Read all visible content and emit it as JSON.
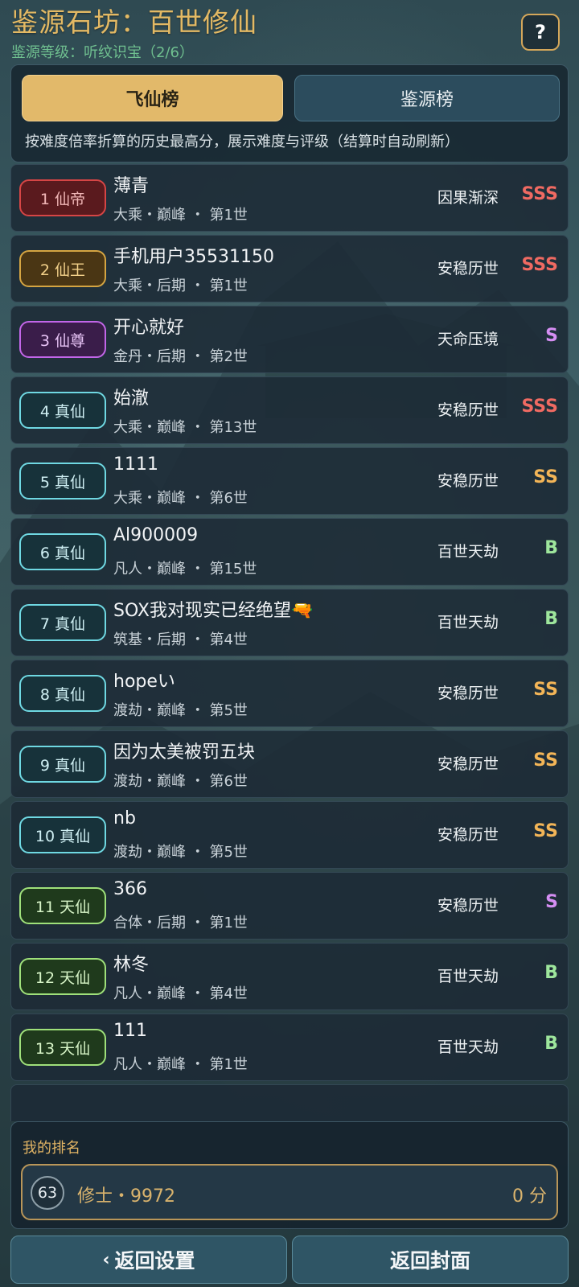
{
  "header": {
    "title": "鉴源石坊：百世修仙",
    "subtitle": "鉴源等级：听纹识宝（2/6）",
    "help_label": "?"
  },
  "tabs": {
    "items": [
      {
        "label": "飞仙榜",
        "active": true
      },
      {
        "label": "鉴源榜",
        "active": false
      }
    ],
    "description": "按难度倍率折算的历史最高分，展示难度与评级（结算时自动刷新）"
  },
  "colors": {
    "gold": "#e2b96a",
    "grade_SSS": "#f06a62",
    "grade_SS": "#f3b557",
    "grade_S": "#d58ef3",
    "grade_B": "#9ee69c"
  },
  "leaderboard": [
    {
      "rank_label": "1 仙帝",
      "name": "薄青",
      "meta": "大乘・巅峰 ・ 第1世",
      "difficulty": "因果渐深",
      "grade": "SSS",
      "badge_border": "#d64545",
      "badge_bg": "#5a1a1e",
      "badge_text": "#f1b7b7"
    },
    {
      "rank_label": "2 仙王",
      "name": "手机用户35531150",
      "meta": "大乘・后期 ・ 第1世",
      "difficulty": "安稳历世",
      "grade": "SSS",
      "badge_border": "#d5a542",
      "badge_bg": "#4a3614",
      "badge_text": "#f3d18a"
    },
    {
      "rank_label": "3 仙尊",
      "name": "开心就好",
      "meta": "金丹・后期 ・ 第2世",
      "difficulty": "天命压境",
      "grade": "S",
      "badge_border": "#c266e8",
      "badge_bg": "#3a1d4a",
      "badge_text": "#e7c3f5"
    },
    {
      "rank_label": "4 真仙",
      "name": "始澈",
      "meta": "大乘・巅峰 ・ 第13世",
      "difficulty": "安稳历世",
      "grade": "SSS",
      "badge_border": "#6fd8e2",
      "badge_bg": "#17323a",
      "badge_text": "#cfeff3"
    },
    {
      "rank_label": "5 真仙",
      "name": "1111",
      "meta": "大乘・巅峰 ・ 第6世",
      "difficulty": "安稳历世",
      "grade": "SS",
      "badge_border": "#6fd8e2",
      "badge_bg": "#17323a",
      "badge_text": "#cfeff3"
    },
    {
      "rank_label": "6 真仙",
      "name": "Al900009",
      "meta": "凡人・巅峰 ・ 第15世",
      "difficulty": "百世天劫",
      "grade": "B",
      "badge_border": "#6fd8e2",
      "badge_bg": "#17323a",
      "badge_text": "#cfeff3"
    },
    {
      "rank_label": "7 真仙",
      "name": "SOX我对现实已经绝望🔫",
      "meta": "筑基・后期 ・ 第4世",
      "difficulty": "百世天劫",
      "grade": "B",
      "badge_border": "#6fd8e2",
      "badge_bg": "#17323a",
      "badge_text": "#cfeff3"
    },
    {
      "rank_label": "8 真仙",
      "name": "hopeい",
      "meta": "渡劫・巅峰 ・ 第5世",
      "difficulty": "安稳历世",
      "grade": "SS",
      "badge_border": "#6fd8e2",
      "badge_bg": "#17323a",
      "badge_text": "#cfeff3"
    },
    {
      "rank_label": "9 真仙",
      "name": "因为太美被罚五块",
      "meta": "渡劫・巅峰 ・ 第6世",
      "difficulty": "安稳历世",
      "grade": "SS",
      "badge_border": "#6fd8e2",
      "badge_bg": "#17323a",
      "badge_text": "#cfeff3"
    },
    {
      "rank_label": "10 真仙",
      "name": "nb",
      "meta": "渡劫・巅峰 ・ 第5世",
      "difficulty": "安稳历世",
      "grade": "SS",
      "badge_border": "#6fd8e2",
      "badge_bg": "#17323a",
      "badge_text": "#cfeff3"
    },
    {
      "rank_label": "11 天仙",
      "name": "366",
      "meta": "合体・后期 ・ 第1世",
      "difficulty": "安稳历世",
      "grade": "S",
      "badge_border": "#9fe07a",
      "badge_bg": "#1f3a1c",
      "badge_text": "#d8f5c8"
    },
    {
      "rank_label": "12 天仙",
      "name": "林冬",
      "meta": "凡人・巅峰 ・ 第4世",
      "difficulty": "百世天劫",
      "grade": "B",
      "badge_border": "#9fe07a",
      "badge_bg": "#1f3a1c",
      "badge_text": "#d8f5c8"
    },
    {
      "rank_label": "13 天仙",
      "name": "111",
      "meta": "凡人・巅峰 ・ 第1世",
      "difficulty": "百世天劫",
      "grade": "B",
      "badge_border": "#9fe07a",
      "badge_bg": "#1f3a1c",
      "badge_text": "#d8f5c8"
    }
  ],
  "my_rank": {
    "label": "我的排名",
    "rank": "63",
    "name": "修士・9972",
    "score": "0 分"
  },
  "bottom_buttons": {
    "back_settings": "返回设置",
    "back_cover": "返回封面",
    "chevron": "‹"
  }
}
